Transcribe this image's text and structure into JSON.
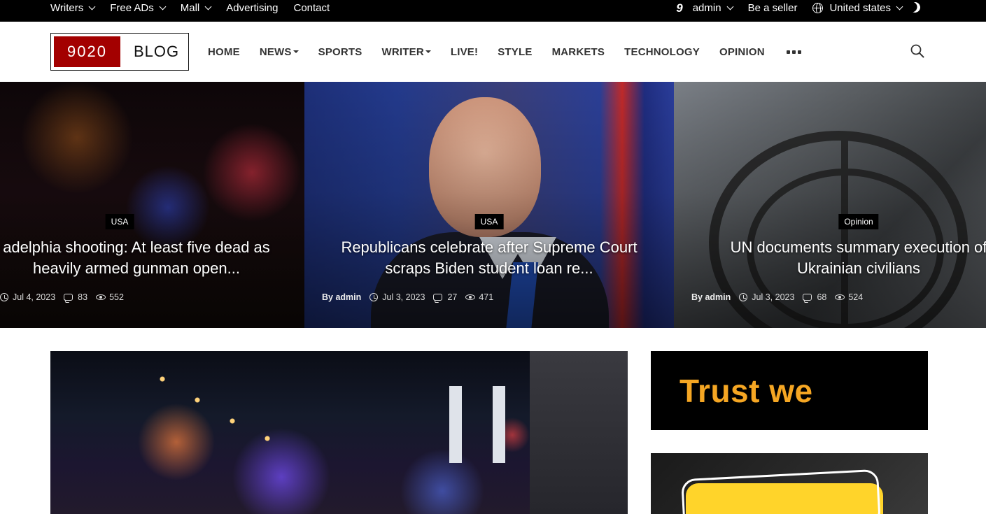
{
  "topbar": {
    "left_items": [
      {
        "label": "Writers",
        "dropdown": true
      },
      {
        "label": "Free ADs",
        "dropdown": true
      },
      {
        "label": "Mall",
        "dropdown": true
      },
      {
        "label": "Advertising",
        "dropdown": false
      },
      {
        "label": "Contact",
        "dropdown": false
      }
    ],
    "user_icon_glyph": "9",
    "user_label": "admin",
    "seller_label": "Be a seller",
    "country_label": "United states",
    "icons": [
      "user-icon",
      "globe-icon",
      "moon-icon"
    ]
  },
  "header": {
    "logo_number": "9020",
    "logo_text": "BLOG",
    "nav": [
      {
        "label": "HOME",
        "dropdown": false
      },
      {
        "label": "NEWS",
        "dropdown": true
      },
      {
        "label": "SPORTS",
        "dropdown": false
      },
      {
        "label": "WRITER",
        "dropdown": true
      },
      {
        "label": "LIVE!",
        "dropdown": false
      },
      {
        "label": "STYLE",
        "dropdown": false
      },
      {
        "label": "MARKETS",
        "dropdown": false
      },
      {
        "label": "TECHNOLOGY",
        "dropdown": false
      },
      {
        "label": "OPINION",
        "dropdown": false
      }
    ],
    "more_icon": "more-dots-icon",
    "search_icon": "search-icon"
  },
  "hero": {
    "slides": [
      {
        "category": "USA",
        "title_line1": "adelphia shooting: At least five dead as",
        "title_line2": "heavily armed gunman open...",
        "author": "",
        "date": "Jul 4, 2023",
        "comments": "83",
        "views": "552"
      },
      {
        "category": "USA",
        "title_line1": "Republicans celebrate after Supreme Court",
        "title_line2": "scraps Biden student loan re...",
        "author": "By admin",
        "date": "Jul 3, 2023",
        "comments": "27",
        "views": "471"
      },
      {
        "category": "Opinion",
        "title_line1": "UN documents summary execution of",
        "title_line2": "Ukrainian civilians",
        "author": "By admin",
        "date": "Jul 3, 2023",
        "comments": "68",
        "views": "524"
      }
    ]
  },
  "sidebar": {
    "ad1_text": "Trust we"
  },
  "colors": {
    "topbar_bg": "#000000",
    "logo_red": "#a30000",
    "ad_text": "#f5a623",
    "ad_card": "#ffd42a"
  }
}
